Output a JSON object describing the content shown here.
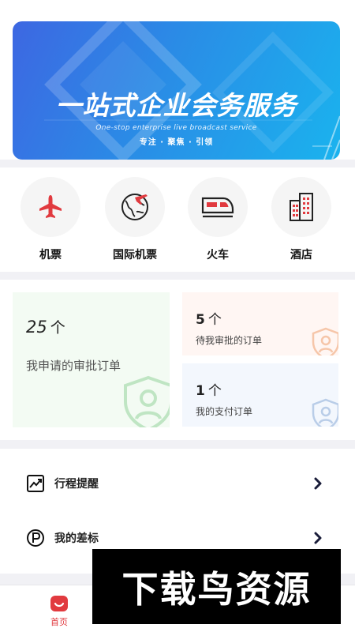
{
  "banner": {
    "title": "一站式企业会务服务",
    "subtitle": "One-stop enterprise live broadcast service",
    "tagline": "专注 · 聚焦 · 引领"
  },
  "categories": [
    {
      "label": "机票",
      "icon": "airplane-icon"
    },
    {
      "label": "国际机票",
      "icon": "globe-plane-icon"
    },
    {
      "label": "火车",
      "icon": "train-icon"
    },
    {
      "label": "酒店",
      "icon": "hotel-icon"
    }
  ],
  "approvals": {
    "applied": {
      "count": "25",
      "unit": "个",
      "label": "我申请的审批订单"
    },
    "pending": {
      "count": "5",
      "unit": "个",
      "label": "待我审批的订单"
    },
    "payment": {
      "count": "1",
      "unit": "个",
      "label": "我的支付订单"
    }
  },
  "menu": [
    {
      "label": "行程提醒",
      "icon": "trend-chart-icon"
    },
    {
      "label": "我的差标",
      "icon": "p-circle-icon"
    }
  ],
  "tabbar": {
    "home_label": "首页"
  },
  "watermark": "下载鸟资源",
  "colors": {
    "accent_red": "#e13a3f",
    "banner_blue": "#2a8ce6",
    "approve_green_bg": "#f3fbf3",
    "pending_bg": "#fff6f3",
    "payment_bg": "#f3f7fd"
  }
}
